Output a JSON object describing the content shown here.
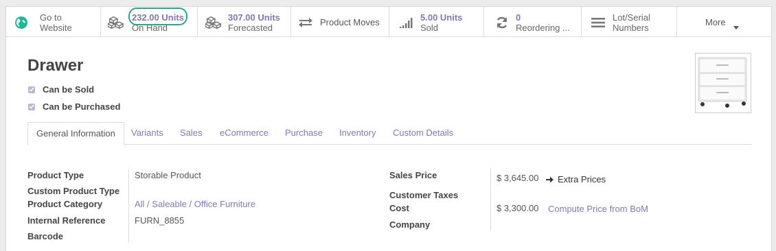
{
  "status_buttons": {
    "website": {
      "line1": "Go to",
      "line2": "Website"
    },
    "on_hand": {
      "value": "232.00 Units",
      "label": "On Hand"
    },
    "forecasted": {
      "value": "307.00 Units",
      "label": "Forecasted"
    },
    "moves": {
      "label": "Product Moves"
    },
    "sold": {
      "value": "5.00 Units",
      "label": "Sold"
    },
    "reordering": {
      "value": "0",
      "label": "Reordering ..."
    },
    "lots": {
      "line1": "Lot/Serial",
      "line2": "Numbers"
    },
    "more": {
      "label": "More"
    }
  },
  "product": {
    "name": "Drawer",
    "can_be_sold": {
      "label": "Can be Sold",
      "checked": true
    },
    "can_be_purchased": {
      "label": "Can be Purchased",
      "checked": true
    }
  },
  "tabs": [
    {
      "label": "General Information",
      "active": true
    },
    {
      "label": "Variants"
    },
    {
      "label": "Sales"
    },
    {
      "label": "eCommerce"
    },
    {
      "label": "Purchase"
    },
    {
      "label": "Inventory"
    },
    {
      "label": "Custom Details"
    }
  ],
  "fields_left": {
    "product_type": {
      "label": "Product Type",
      "value": "Storable Product"
    },
    "custom_product_type": {
      "label": "Custom Product Type",
      "value": ""
    },
    "product_category": {
      "label": "Product Category",
      "value": "All / Saleable / Office Furniture"
    },
    "internal_reference": {
      "label": "Internal Reference",
      "value": "FURN_8855"
    },
    "barcode": {
      "label": "Barcode",
      "value": ""
    }
  },
  "fields_right": {
    "sales_price": {
      "label": "Sales Price",
      "value": "$ 3,645.00",
      "action": "Extra Prices"
    },
    "customer_taxes": {
      "label": "Customer Taxes",
      "value": ""
    },
    "cost": {
      "label": "Cost",
      "value": "$ 3,300.00",
      "action": "Compute Price from BoM"
    },
    "company": {
      "label": "Company",
      "value": ""
    }
  },
  "colors": {
    "accent": "#7c7bad",
    "highlight": "#2aa58b",
    "globe": "#21b799"
  }
}
